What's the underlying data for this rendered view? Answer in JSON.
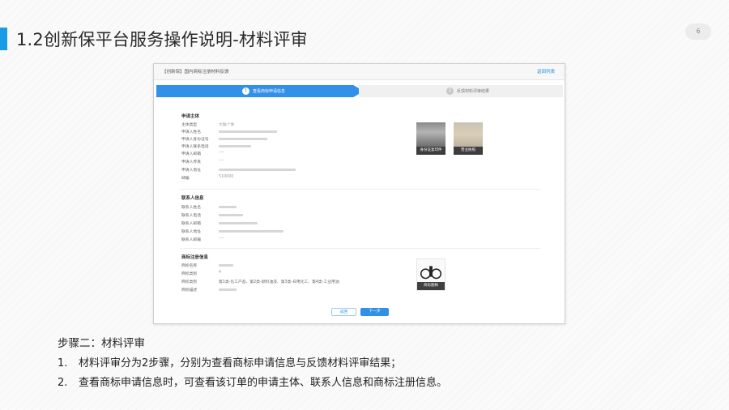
{
  "slide": {
    "title": "1.2创新保平台服务操作说明-材料评审",
    "page_number": "6",
    "accent_color": "#1a9be8"
  },
  "screenshot": {
    "header_title": "【创新保】国内商标注册材料反馈",
    "back_link": "返回列表",
    "steps": [
      {
        "num": "1",
        "label": "查看商标申请信息",
        "active": true
      },
      {
        "num": "2",
        "label": "反馈材料评审结果",
        "active": false
      }
    ],
    "applicant": {
      "title": "申请主体",
      "fields": [
        {
          "label": "主体类型",
          "value": "大陆个体"
        },
        {
          "label": "申请人姓名",
          "value": ""
        },
        {
          "label": "申请人身份证号",
          "value": ""
        },
        {
          "label": "申请人联系电话",
          "value": ""
        },
        {
          "label": "申请人邮箱",
          "value": "----"
        },
        {
          "label": "申请人传真",
          "value": "----"
        },
        {
          "label": "申请人地址",
          "value": ""
        },
        {
          "label": "邮编",
          "value": "510000"
        }
      ],
      "images": [
        {
          "caption": "身份证复印件",
          "icon": "id-card-image-icon"
        },
        {
          "caption": "营业执照",
          "icon": "business-license-image-icon"
        }
      ]
    },
    "contact": {
      "title": "联系人信息",
      "fields": [
        {
          "label": "联系人姓名",
          "value": ""
        },
        {
          "label": "联系人电话",
          "value": ""
        },
        {
          "label": "联系人邮箱",
          "value": ""
        },
        {
          "label": "联系人地址",
          "value": ""
        },
        {
          "label": "联系人邮编",
          "value": "----"
        }
      ]
    },
    "trademark": {
      "title": "商标注册信息",
      "fields": [
        {
          "label": "商标名称",
          "value": ""
        },
        {
          "label": "商标类别",
          "value": "4"
        },
        {
          "label": "商标类别",
          "value": "第1类-化工产品、第2类-颜料油漆、第3类-日用化工、第4类-工业用油"
        },
        {
          "label": "商标描述",
          "value": ""
        }
      ],
      "image": {
        "caption": "商标图样",
        "icon": "trademark-image-icon"
      }
    },
    "buttons": {
      "back": "返回",
      "next": "下一步"
    },
    "primary_color": "#3390e8"
  },
  "bottom": {
    "title": "步骤二：材料评审",
    "items": [
      {
        "num": "1.",
        "text": "材料评审分为2步骤，分别为查看商标申请信息与反馈材料评审结果；"
      },
      {
        "num": "2.",
        "text": "查看商标申请信息时，可查看该订单的申请主体、联系人信息和商标注册信息。"
      }
    ]
  }
}
